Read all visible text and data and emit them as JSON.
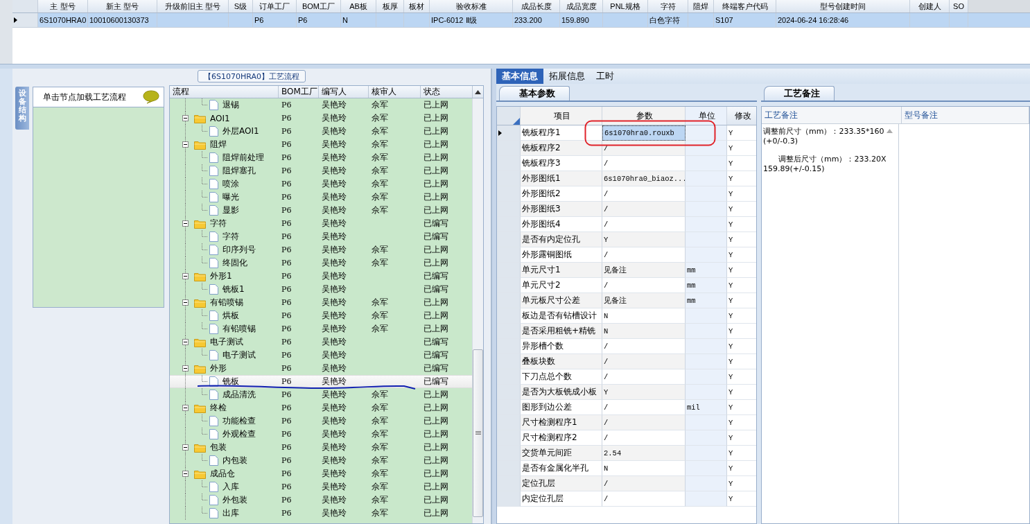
{
  "model_grid": {
    "columns": [
      "主 型号",
      "新主 型号",
      "升级前旧主 型号",
      "S级",
      "订单工厂",
      "BOM工厂",
      "AB板",
      "板厚",
      "板材",
      "验收标准",
      "成品长度",
      "成品宽度",
      "PNL规格",
      "字符",
      "阻焊",
      "终端客户代码",
      "型号创建时间",
      "创建人",
      "SO"
    ],
    "rows": [
      {
        "selected": true,
        "cells": [
          "6S1070HRA0",
          "10010600130373",
          "",
          "",
          "P6",
          "P6",
          "N",
          "",
          "",
          "IPC-6012 Ⅱ级",
          "233.200",
          "159.890",
          "",
          "白色字符",
          "",
          "S107",
          "2024-06-24 16:28:46",
          "",
          ""
        ]
      }
    ]
  },
  "flow": {
    "title": "【6S1070HRA0】工艺流程",
    "side_tab": "设备结构",
    "hint": "单击节点加载工艺流程",
    "columns": [
      "流程",
      "BOM工厂",
      "编写人",
      "核审人",
      "状态"
    ],
    "rows": [
      {
        "kind": "step",
        "name": "退锡",
        "bom": "P6",
        "author": "吴艳玲",
        "reviewer": "佘军",
        "status": "已上网",
        "selected": false
      },
      {
        "kind": "stage",
        "name": "AOI1",
        "bom": "P6",
        "author": "吴艳玲",
        "reviewer": "佘军",
        "status": "已上网",
        "selected": false,
        "expanded": true,
        "children": [
          {
            "kind": "step",
            "name": "外层AOI1",
            "bom": "P6",
            "author": "吴艳玲",
            "reviewer": "佘军",
            "status": "已上网",
            "selected": false
          }
        ]
      },
      {
        "kind": "stage",
        "name": "阻焊",
        "bom": "P6",
        "author": "吴艳玲",
        "reviewer": "佘军",
        "status": "已上网",
        "selected": false,
        "expanded": true,
        "children": [
          {
            "kind": "step",
            "name": "阻焊前处理",
            "bom": "P6",
            "author": "吴艳玲",
            "reviewer": "佘军",
            "status": "已上网",
            "selected": false
          },
          {
            "kind": "step",
            "name": "阻焊塞孔",
            "bom": "P6",
            "author": "吴艳玲",
            "reviewer": "佘军",
            "status": "已上网",
            "selected": false
          },
          {
            "kind": "step",
            "name": "喷涂",
            "bom": "P6",
            "author": "吴艳玲",
            "reviewer": "佘军",
            "status": "已上网",
            "selected": false
          },
          {
            "kind": "step",
            "name": "曝光",
            "bom": "P6",
            "author": "吴艳玲",
            "reviewer": "佘军",
            "status": "已上网",
            "selected": false
          },
          {
            "kind": "step",
            "name": "显影",
            "bom": "P6",
            "author": "吴艳玲",
            "reviewer": "佘军",
            "status": "已上网",
            "selected": false
          }
        ]
      },
      {
        "kind": "stage",
        "name": "字符",
        "bom": "P6",
        "author": "吴艳玲",
        "status": "已编写",
        "selected": false,
        "expanded": true,
        "children": [
          {
            "kind": "step",
            "name": "字符",
            "bom": "P6",
            "author": "吴艳玲",
            "status": "已编写",
            "selected": false
          },
          {
            "kind": "step",
            "name": "印序列号",
            "bom": "P6",
            "author": "吴艳玲",
            "reviewer": "佘军",
            "status": "已上网",
            "selected": false
          },
          {
            "kind": "step",
            "name": "终固化",
            "bom": "P6",
            "author": "吴艳玲",
            "reviewer": "佘军",
            "status": "已上网",
            "selected": false
          }
        ]
      },
      {
        "kind": "stage",
        "name": "外形1",
        "bom": "P6",
        "author": "吴艳玲",
        "status": "已编写",
        "selected": false,
        "expanded": true,
        "children": [
          {
            "kind": "step",
            "name": "铣板1",
            "bom": "P6",
            "author": "吴艳玲",
            "status": "已编写",
            "selected": false
          }
        ]
      },
      {
        "kind": "stage",
        "name": "有铅喷锡",
        "bom": "P6",
        "author": "吴艳玲",
        "reviewer": "佘军",
        "status": "已上网",
        "selected": false,
        "expanded": true,
        "children": [
          {
            "kind": "step",
            "name": "烘板",
            "bom": "P6",
            "author": "吴艳玲",
            "reviewer": "佘军",
            "status": "已上网",
            "selected": false
          },
          {
            "kind": "step",
            "name": "有铅喷锡",
            "bom": "P6",
            "author": "吴艳玲",
            "reviewer": "佘军",
            "status": "已上网",
            "selected": false
          }
        ]
      },
      {
        "kind": "stage",
        "name": "电子测试",
        "bom": "P6",
        "author": "吴艳玲",
        "status": "已编写",
        "selected": false,
        "expanded": true,
        "children": [
          {
            "kind": "step",
            "name": "电子测试",
            "bom": "P6",
            "author": "吴艳玲",
            "status": "已编写",
            "selected": false
          }
        ]
      },
      {
        "kind": "stage",
        "name": "外形",
        "bom": "P6",
        "author": "吴艳玲",
        "status": "已编写",
        "selected": false,
        "expanded": true,
        "children": [
          {
            "kind": "step",
            "name": "铣板",
            "bom": "P6",
            "author": "吴艳玲",
            "status": "已编写",
            "selected": true
          },
          {
            "kind": "step",
            "name": "成品清洗",
            "bom": "P6",
            "author": "吴艳玲",
            "reviewer": "佘军",
            "status": "已上网",
            "selected": false
          }
        ]
      },
      {
        "kind": "stage",
        "name": "终检",
        "bom": "P6",
        "author": "吴艳玲",
        "reviewer": "佘军",
        "status": "已上网",
        "selected": false,
        "expanded": true,
        "children": [
          {
            "kind": "step",
            "name": "功能检查",
            "bom": "P6",
            "author": "吴艳玲",
            "reviewer": "佘军",
            "status": "已上网",
            "selected": false
          },
          {
            "kind": "step",
            "name": "外观检查",
            "bom": "P6",
            "author": "吴艳玲",
            "reviewer": "佘军",
            "status": "已上网",
            "selected": false
          }
        ]
      },
      {
        "kind": "stage",
        "name": "包装",
        "bom": "P6",
        "author": "吴艳玲",
        "reviewer": "佘军",
        "status": "已上网",
        "selected": false,
        "expanded": true,
        "children": [
          {
            "kind": "step",
            "name": "内包装",
            "bom": "P6",
            "author": "吴艳玲",
            "reviewer": "佘军",
            "status": "已上网",
            "selected": false
          }
        ]
      },
      {
        "kind": "stage",
        "name": "成品仓",
        "bom": "P6",
        "author": "吴艳玲",
        "reviewer": "佘军",
        "status": "已上网",
        "selected": false,
        "expanded": true,
        "children": [
          {
            "kind": "step",
            "name": "入库",
            "bom": "P6",
            "author": "吴艳玲",
            "reviewer": "佘军",
            "status": "已上网",
            "selected": false
          },
          {
            "kind": "step",
            "name": "外包装",
            "bom": "P6",
            "author": "吴艳玲",
            "reviewer": "佘军",
            "status": "已上网",
            "selected": false
          },
          {
            "kind": "step",
            "name": "出库",
            "bom": "P6",
            "author": "吴艳玲",
            "reviewer": "佘军",
            "status": "已上网",
            "selected": false
          }
        ]
      }
    ]
  },
  "detail_tabs": [
    {
      "label": "基本信息",
      "selected": true
    },
    {
      "label": "拓展信息",
      "selected": false
    },
    {
      "label": "工时",
      "selected": false
    }
  ],
  "params": {
    "tab": "基本参数",
    "columns": [
      "项目",
      "参数",
      "单位",
      "修改"
    ],
    "rows": [
      {
        "item": "铣板程序1",
        "value": "6s1070hra0.rouxb",
        "modified": "Y",
        "selected": true
      },
      {
        "item": "铣板程序2",
        "value": "/",
        "modified": "Y",
        "selected": false
      },
      {
        "item": "铣板程序3",
        "value": "/",
        "modified": "Y",
        "selected": false
      },
      {
        "item": "外形图纸1",
        "value": "6s1070hra0_biaoz...",
        "modified": "Y",
        "selected": false
      },
      {
        "item": "外形图纸2",
        "value": "/",
        "modified": "Y",
        "selected": false
      },
      {
        "item": "外形图纸3",
        "value": "/",
        "modified": "Y",
        "selected": false
      },
      {
        "item": "外形图纸4",
        "value": "/",
        "modified": "Y",
        "selected": false
      },
      {
        "item": "是否有内定位孔",
        "value": "Y",
        "modified": "Y",
        "selected": false
      },
      {
        "item": "外形露铜图纸",
        "value": "/",
        "modified": "Y",
        "selected": false
      },
      {
        "item": "单元尺寸1",
        "value": "见备注",
        "unit": "mm",
        "modified": "Y",
        "selected": false
      },
      {
        "item": "单元尺寸2",
        "value": "/",
        "unit": "mm",
        "modified": "Y",
        "selected": false
      },
      {
        "item": "单元板尺寸公差",
        "value": "见备注",
        "unit": "mm",
        "modified": "Y",
        "selected": false
      },
      {
        "item": "板边是否有钻槽设计",
        "value": "N",
        "modified": "Y",
        "selected": false
      },
      {
        "item": "是否采用粗铣+精铣",
        "value": "N",
        "modified": "Y",
        "selected": false
      },
      {
        "item": "异形槽个数",
        "value": "/",
        "modified": "Y",
        "selected": false
      },
      {
        "item": "叠板块数",
        "value": "/",
        "modified": "Y",
        "selected": false
      },
      {
        "item": "下刀点总个数",
        "value": "/",
        "modified": "Y",
        "selected": false
      },
      {
        "item": "是否为大板铣成小板",
        "value": "Y",
        "modified": "Y",
        "selected": false
      },
      {
        "item": "图形到边公差",
        "value": "/",
        "unit": "mil",
        "modified": "Y",
        "selected": false
      },
      {
        "item": "尺寸检测程序1",
        "value": "/",
        "modified": "Y",
        "selected": false
      },
      {
        "item": "尺寸检测程序2",
        "value": "/",
        "modified": "Y",
        "selected": false
      },
      {
        "item": "交货单元间距",
        "value": "2.54",
        "modified": "Y",
        "selected": false
      },
      {
        "item": "是否有金属化半孔",
        "value": "N",
        "modified": "Y",
        "selected": false
      },
      {
        "item": "定位孔层",
        "value": "/",
        "modified": "Y",
        "selected": false
      },
      {
        "item": "内定位孔层",
        "value": "/",
        "modified": "Y",
        "selected": false
      }
    ]
  },
  "notes": {
    "tab": "工艺备注",
    "columns": [
      "工艺备注",
      "型号备注"
    ],
    "process_note": [
      "调整前尺寸（mm）：233.35*160(+0/-0.3)",
      "　　调整后尺寸（mm）：233.20X159.89(+/-0.15)"
    ]
  }
}
